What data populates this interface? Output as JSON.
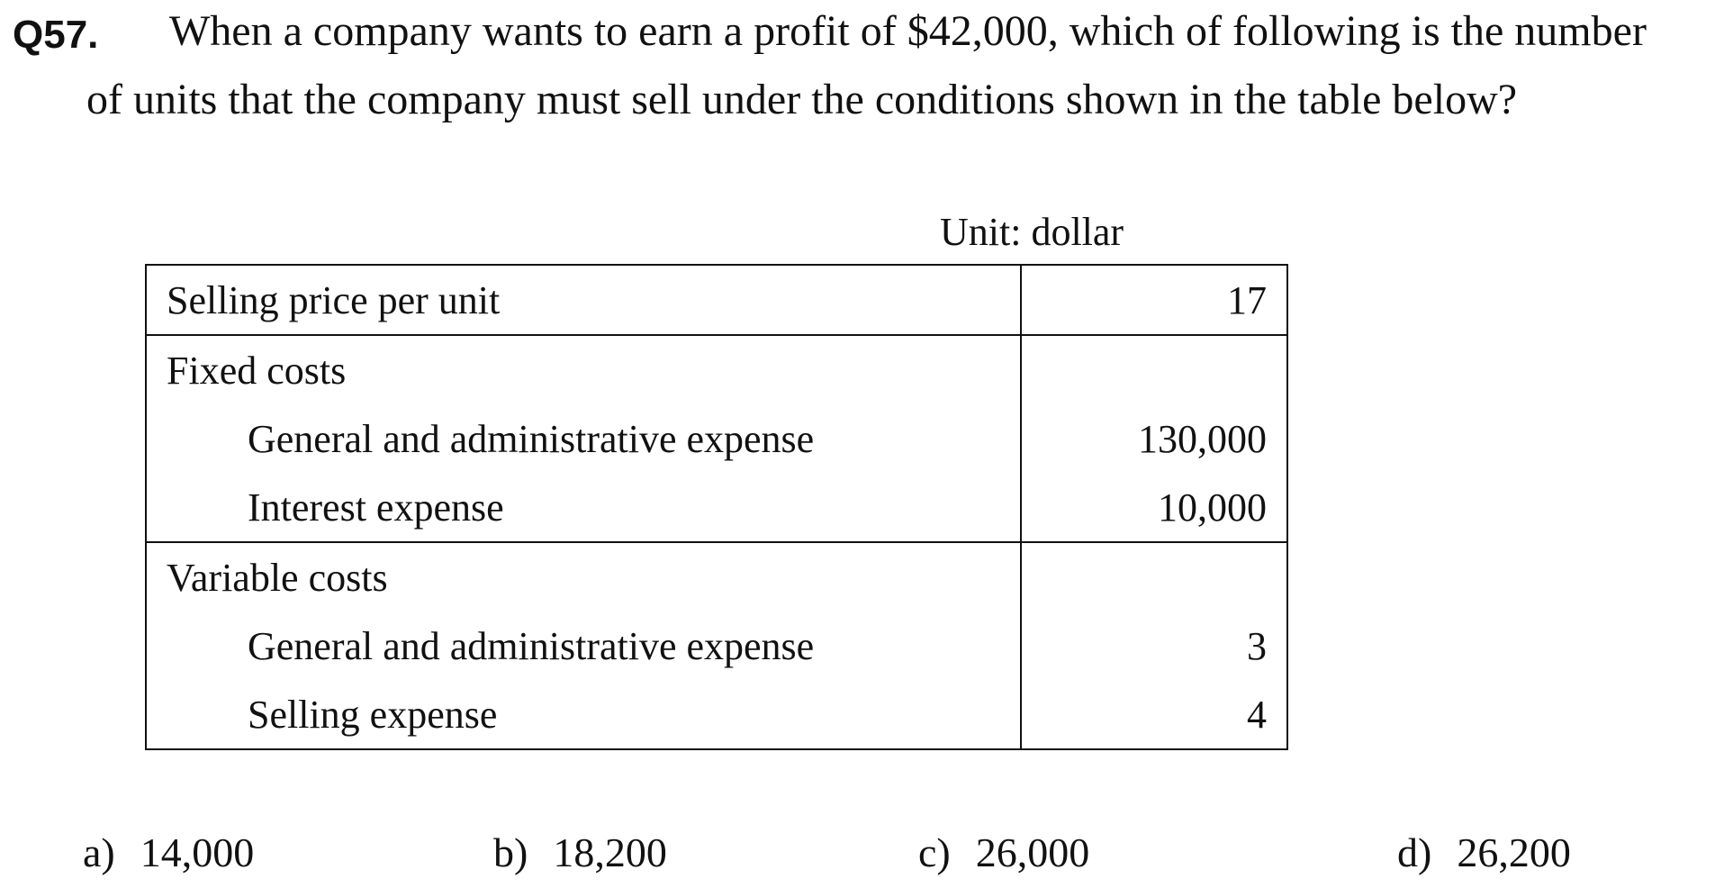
{
  "question": {
    "number": "Q57.",
    "line1": "When a company wants to earn a profit of $42,000, which of following is the number",
    "line2": "of units that the company must sell under the conditions shown in the table below?"
  },
  "table": {
    "unit_note": "Unit: dollar",
    "rows": [
      {
        "label": "Selling price per unit",
        "value": "17"
      },
      {
        "label": "Fixed costs",
        "value": ""
      },
      {
        "label": "General and administrative expense",
        "value": "130,000"
      },
      {
        "label": "Interest expense",
        "value": "10,000"
      },
      {
        "label": "Variable costs",
        "value": ""
      },
      {
        "label": "General and administrative expense",
        "value": "3"
      },
      {
        "label": "Selling expense",
        "value": "4"
      }
    ]
  },
  "options": [
    {
      "letter": "a)",
      "value": "14,000"
    },
    {
      "letter": "b)",
      "value": "18,200"
    },
    {
      "letter": "c)",
      "value": "26,000"
    },
    {
      "letter": "d)",
      "value": "26,200"
    }
  ]
}
